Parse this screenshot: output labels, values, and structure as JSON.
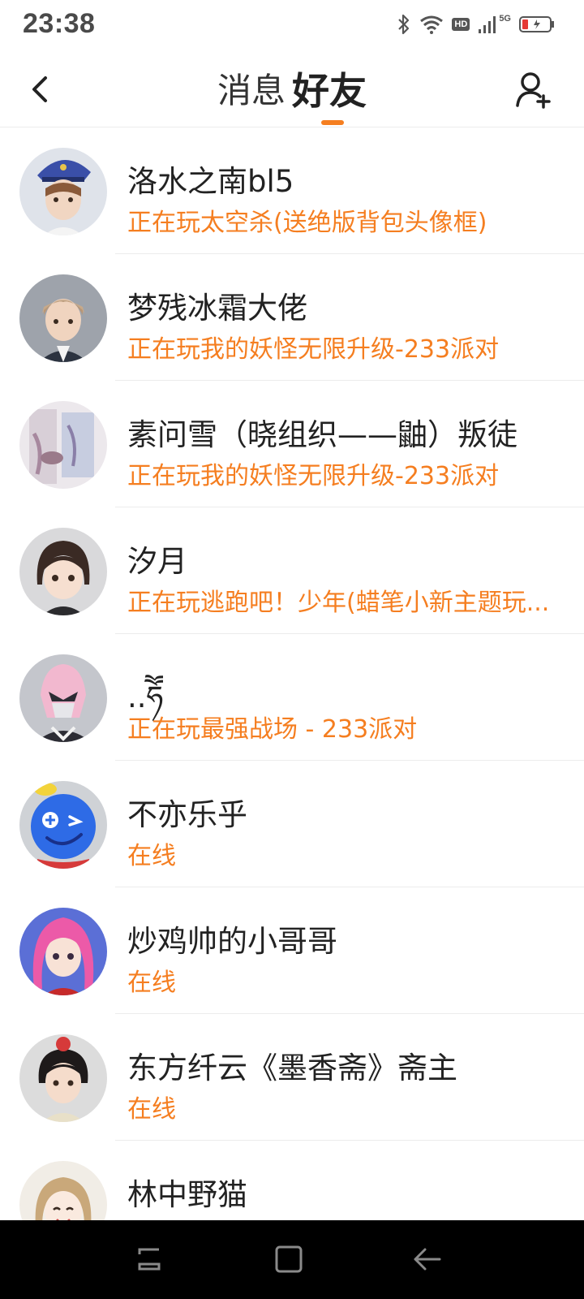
{
  "status_bar": {
    "time": "23:38",
    "icons": [
      "bluetooth-icon",
      "wifi-icon",
      "hd-icon",
      "signal-icon",
      "5g-icon",
      "battery-icon"
    ],
    "hd_label": "HD",
    "network_label": "5G"
  },
  "header": {
    "tabs": [
      {
        "label": "消息",
        "active": false
      },
      {
        "label": "好友",
        "active": true
      }
    ],
    "accent_color": "#f57e20"
  },
  "friends": [
    {
      "name": "洛水之南bl5",
      "status": "正在玩太空杀(送绝版背包头像框)",
      "avatar": "avatar-boy-police-cap"
    },
    {
      "name": "梦残冰霜大佬",
      "status": "正在玩我的妖怪无限升级-233派对",
      "avatar": "avatar-boy-suit"
    },
    {
      "name": "素问雪（晓组织——鼬）叛徒",
      "status": "正在玩我的妖怪无限升级-233派对",
      "avatar": "avatar-photo"
    },
    {
      "name": "汐月",
      "status": "正在玩逃跑吧！少年(蜡笔小新主题玩...",
      "avatar": "avatar-girl-short-hair"
    },
    {
      "name": "..ཧཽ",
      "status": "正在玩最强战场 - 233派对",
      "avatar": "avatar-pink-helmet"
    },
    {
      "name": "不亦乐乎",
      "status": "在线",
      "avatar": "avatar-blue-mascot"
    },
    {
      "name": "炒鸡帅的小哥哥",
      "status": "在线",
      "avatar": "avatar-pink-hair-girl"
    },
    {
      "name": "东方纤云《墨香斋》斋主",
      "status": "在线",
      "avatar": "avatar-boy-red-hat"
    },
    {
      "name": "林中野猫",
      "status": "",
      "avatar": "avatar-girl-smiling"
    }
  ],
  "system_nav": {
    "buttons": [
      "recent-apps-icon",
      "home-icon",
      "back-icon"
    ]
  }
}
